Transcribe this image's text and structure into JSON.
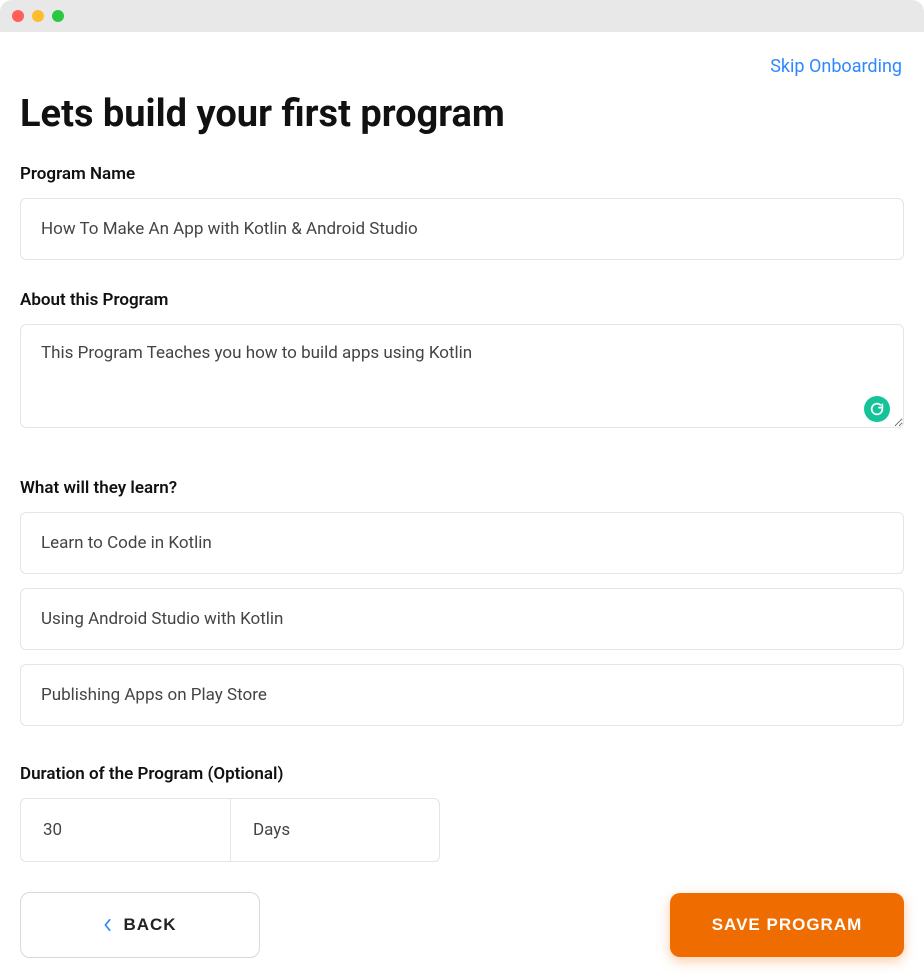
{
  "header": {
    "skip_label": "Skip Onboarding",
    "title": "Lets build your first program"
  },
  "program_name": {
    "label": "Program Name",
    "value": "How To Make An App with Kotlin & Android Studio"
  },
  "about": {
    "label": "About this Program",
    "value": "This Program Teaches you how to build apps using Kotlin"
  },
  "learn": {
    "label": "What will they learn?",
    "items": [
      "Learn to Code in Kotlin",
      "Using Android Studio with Kotlin",
      "Publishing Apps on Play Store"
    ]
  },
  "duration": {
    "label": "Duration of the Program (Optional)",
    "value": "30",
    "unit": "Days"
  },
  "footer": {
    "back_label": "BACK",
    "save_label": "SAVE PROGRAM"
  },
  "colors": {
    "accent": "#ef6c00",
    "link": "#2f88ff",
    "grammarly": "#15c39a"
  }
}
